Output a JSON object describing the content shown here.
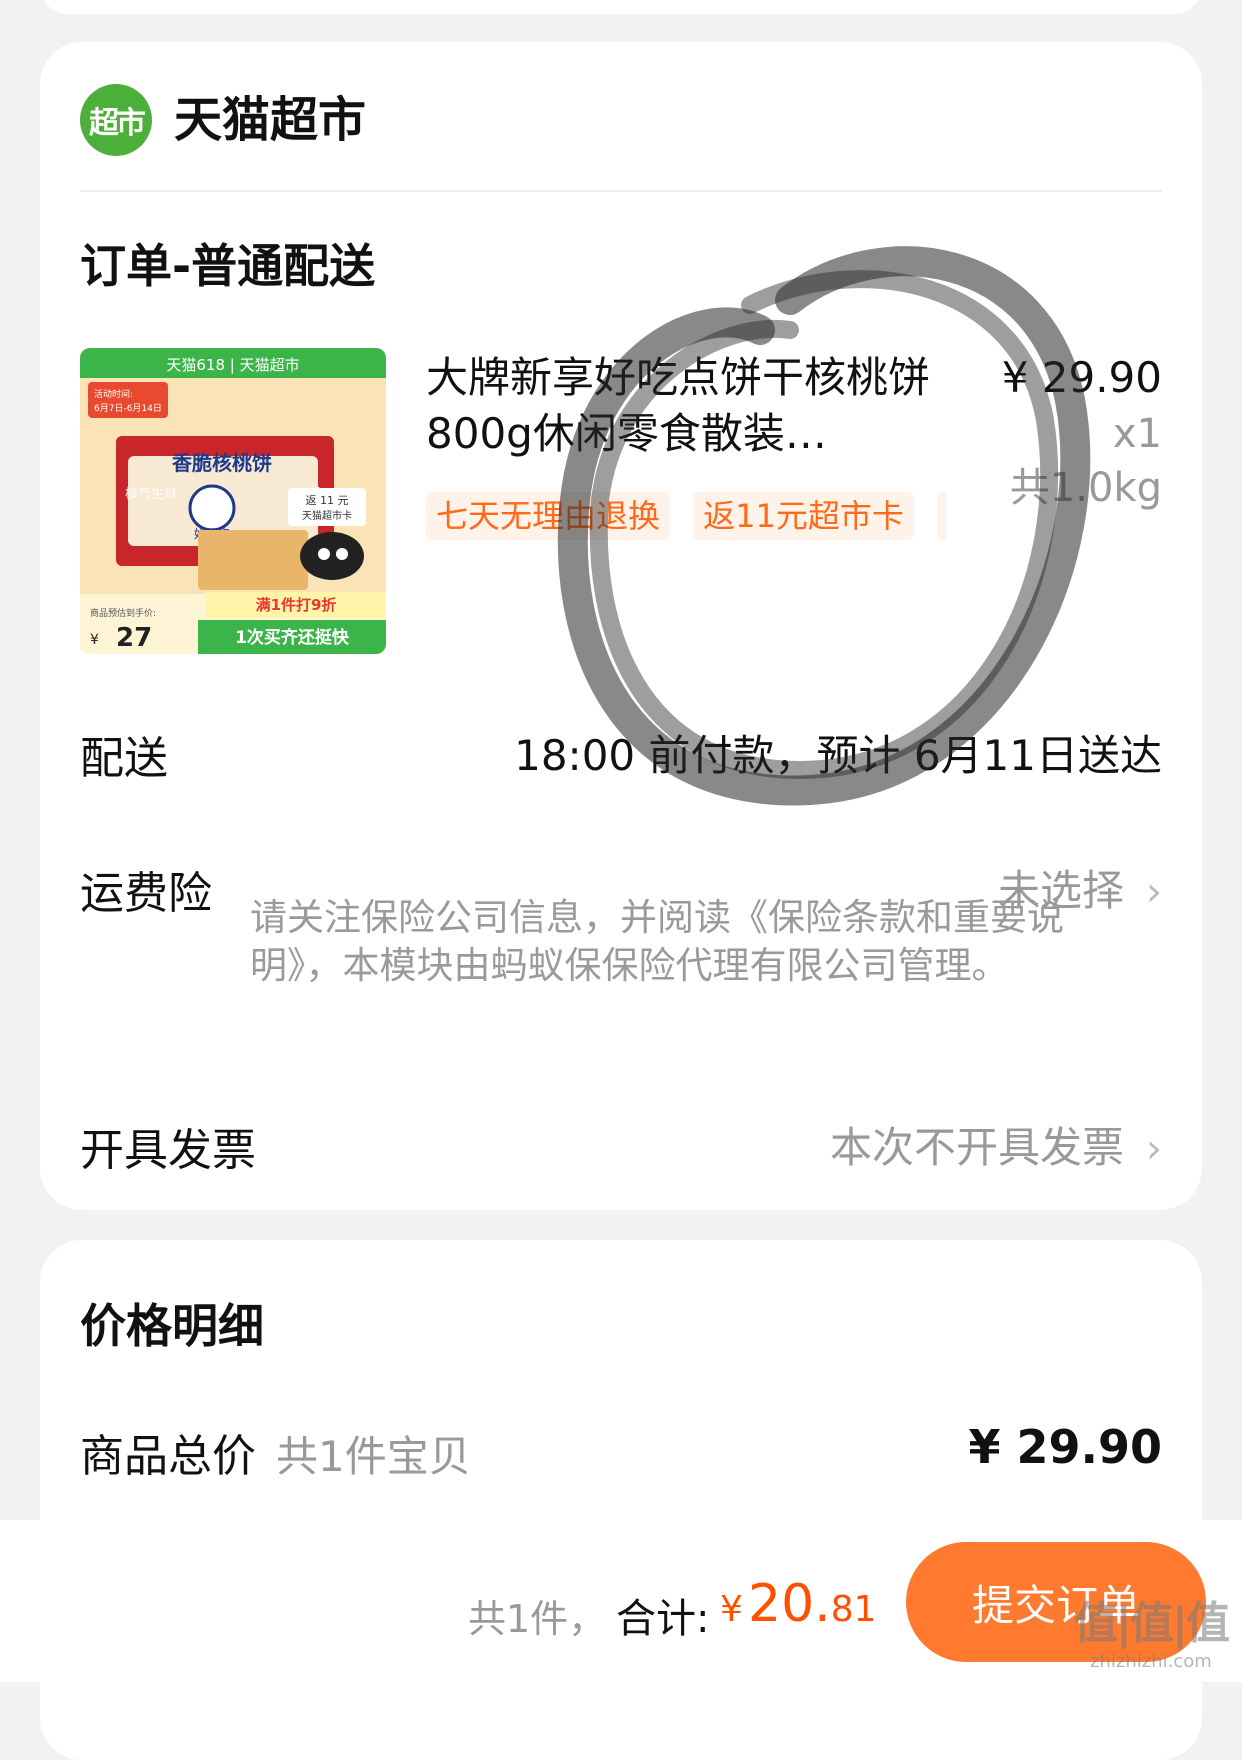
{
  "store": {
    "logo_text": "超市",
    "name": "天猫超市"
  },
  "order": {
    "type_title": "订单-普通配送",
    "product": {
      "title": "大牌新享好吃点饼干核桃饼800g休闲零食散装…",
      "price": "¥ 29.90",
      "quantity": "x1",
      "weight": "共1.0kg",
      "tags": [
        "七天无理由退换",
        "返11元超市卡"
      ],
      "image": {
        "banner": "天猫618 | 天猫超市",
        "activity_label": "活动时间:",
        "activity_dates": "6月7日-6月14日",
        "box_title": "香脆核桃饼",
        "side_text_left": "核气生财",
        "side_text_right": "食",
        "brand": "好吃点",
        "rebate_line1": "返 11 元",
        "rebate_line2": "天猫超市卡",
        "promo": "满1件打9折",
        "est_price_label": "商品预估到手价:",
        "est_price_currency": "¥",
        "est_price": "27",
        "slogan": "1次买齐还挺快"
      }
    }
  },
  "delivery": {
    "label": "配送",
    "value": "18:00 前付款，预计 6月11日送达"
  },
  "insurance": {
    "label": "运费险",
    "value": "未选择",
    "notice": "请关注保险公司信息，并阅读《保险条款和重要说明》，本模块由蚂蚁保保险代理有限公司管理。"
  },
  "invoice": {
    "label": "开具发票",
    "value": "本次不开具发票"
  },
  "price_detail": {
    "title": "价格明细",
    "subtotal_label": "商品总价",
    "subtotal_sub": "共1件宝贝",
    "subtotal_value": "¥ 29.90"
  },
  "footer": {
    "count": "共1件，",
    "total_label": "合计:",
    "total_currency": "¥",
    "total_int": "20.",
    "total_dec": "81",
    "submit_label": "提交订单"
  },
  "watermark": {
    "text": "值|值|值",
    "url": "zhizhizhi.com"
  },
  "icons": {
    "chevron": "chevron-right-icon",
    "logo": "supermarket-logo-icon"
  },
  "colors": {
    "accent": "#ff5000",
    "button": "#ff7a2f",
    "tag_bg": "#fff2e8",
    "tag_text": "#ff6a1a",
    "logo_green": "#4caf3a"
  }
}
